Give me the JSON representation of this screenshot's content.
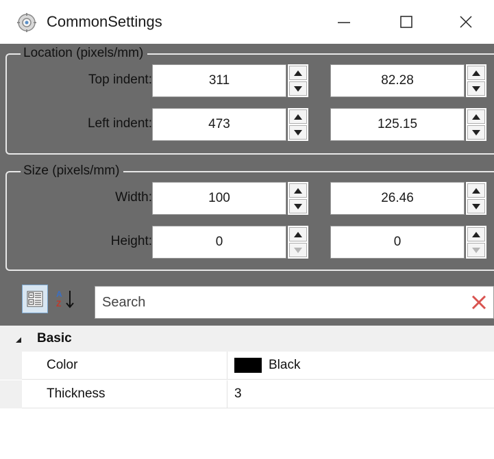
{
  "window": {
    "title": "CommonSettings"
  },
  "location_group": {
    "title": "Location (pixels/mm)",
    "rows": [
      {
        "label": "Top indent:",
        "pixels": "311",
        "mm": "82.28"
      },
      {
        "label": "Left indent:",
        "pixels": "473",
        "mm": "125.15"
      }
    ]
  },
  "size_group": {
    "title": "Size (pixels/mm)",
    "rows": [
      {
        "label": "Width:",
        "pixels": "100",
        "mm": "26.46"
      },
      {
        "label": "Height:",
        "pixels": "0",
        "mm": "0"
      }
    ]
  },
  "property_grid": {
    "search_placeholder": "Search",
    "category": "Basic",
    "properties": [
      {
        "name": "Color",
        "value": "Black",
        "swatch_color": "#000000"
      },
      {
        "name": "Thickness",
        "value": "3"
      }
    ]
  },
  "colors": {
    "panel_background": "#6b6b6b",
    "clear_icon": "#d9534f"
  }
}
